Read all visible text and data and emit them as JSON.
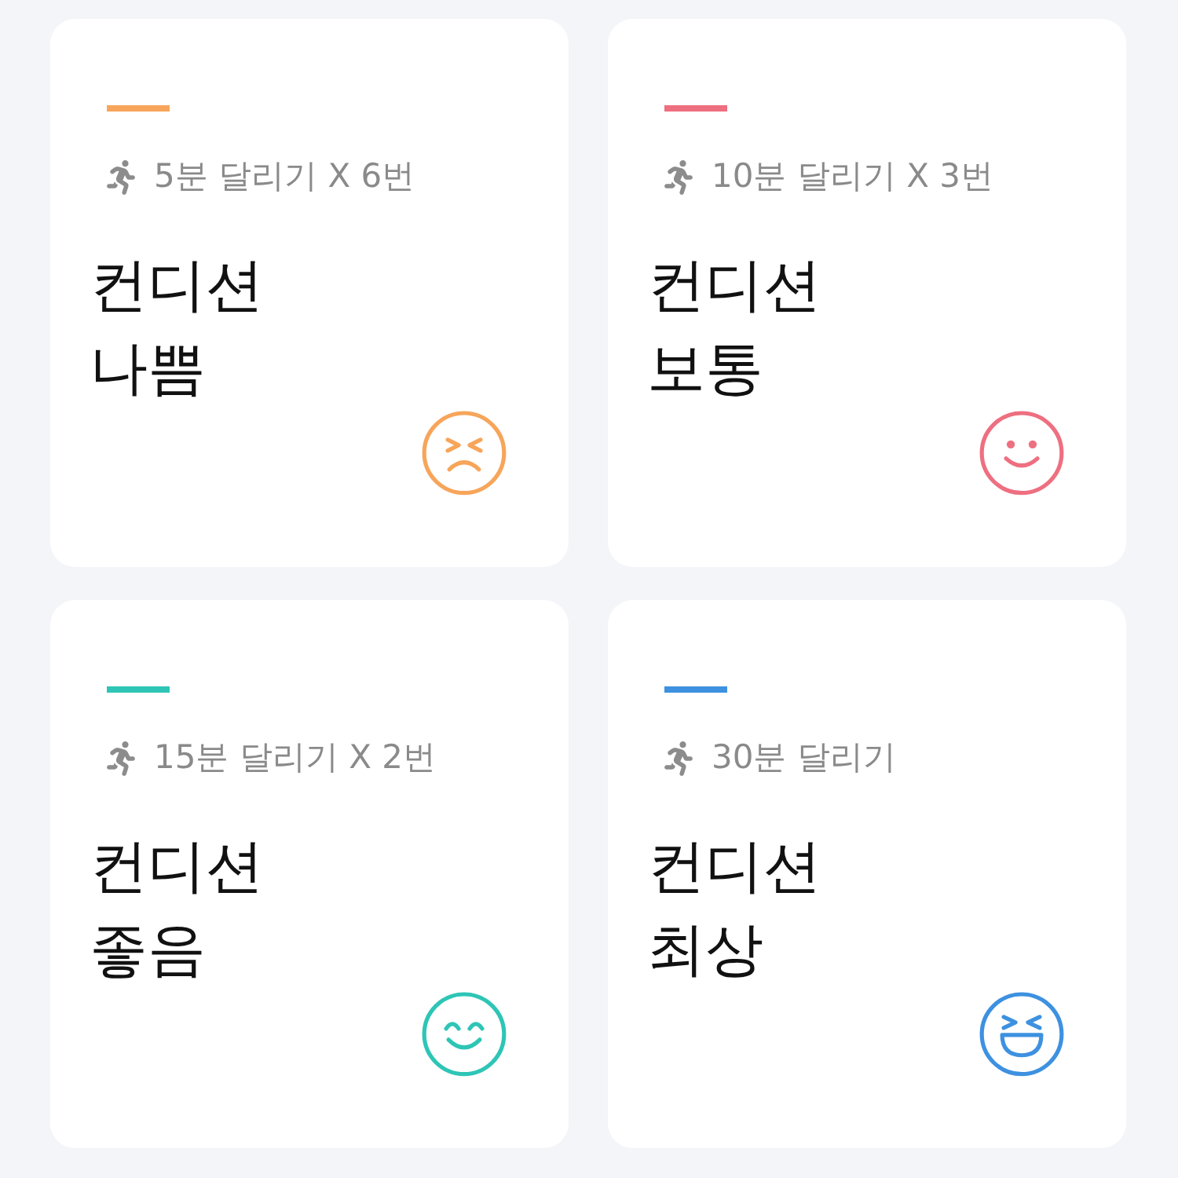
{
  "cards": [
    {
      "color": "#f7a55a",
      "subtitle": "5분 달리기 X 6번",
      "title_lines": [
        "컨디션",
        "나쁨"
      ],
      "mood": {
        "kind": "upset"
      }
    },
    {
      "color": "#ee6f80",
      "subtitle": "10분 달리기 X 3번",
      "title_lines": [
        "컨디션",
        "보통"
      ],
      "mood": {
        "kind": "smile"
      }
    },
    {
      "color": "#2ec5b6",
      "subtitle": "15분 달리기 X 2번",
      "title_lines": [
        "컨디션",
        "좋음"
      ],
      "mood": {
        "kind": "happy"
      }
    },
    {
      "color": "#3d91e0",
      "subtitle": "30분 달리기",
      "title_lines": [
        "컨디션",
        "최상"
      ],
      "mood": {
        "kind": "laugh"
      }
    }
  ]
}
